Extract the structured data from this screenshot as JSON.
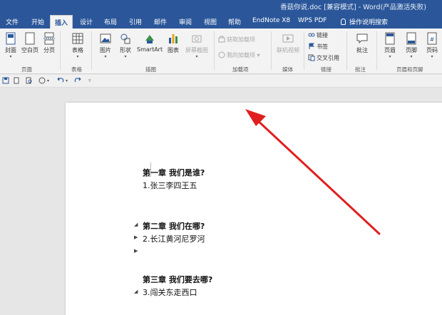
{
  "window": {
    "title": "香菇你说.doc [兼容模式] - Word(产品激活失败)"
  },
  "tabs": [
    {
      "label": "文件"
    },
    {
      "label": "开始"
    },
    {
      "label": "插入"
    },
    {
      "label": "设计"
    },
    {
      "label": "布局"
    },
    {
      "label": "引用"
    },
    {
      "label": "邮件"
    },
    {
      "label": "审阅"
    },
    {
      "label": "视图"
    },
    {
      "label": "帮助"
    },
    {
      "label": "EndNote X8"
    },
    {
      "label": "WPS PDF"
    },
    {
      "label": "操作说明搜索"
    }
  ],
  "active_tab": "插入",
  "ribbon": {
    "pages": {
      "group": "页面",
      "cover": "封面",
      "blank": "空白页",
      "break": "分页"
    },
    "tables": {
      "group": "表格",
      "table": "表格"
    },
    "illustrations": {
      "group": "插图",
      "picture": "图片",
      "shapes": "形状",
      "smartart": "SmartArt",
      "chart": "图表",
      "screenshot": "屏幕截图"
    },
    "addins": {
      "group": "加载项",
      "get": "获取加载项",
      "my": "我的加载项"
    },
    "media": {
      "group": "媒体",
      "video": "联机视频"
    },
    "links": {
      "group": "链接",
      "link": "链接",
      "bookmark": "书签",
      "crossref": "交叉引用"
    },
    "comments": {
      "group": "批注",
      "comment": "批注"
    },
    "headerfooter": {
      "group": "页眉和页脚",
      "header": "页眉",
      "footer": "页脚",
      "pagenum": "页码"
    }
  },
  "document": {
    "lines": [
      "第一章  我们是谁?",
      "1.张三李四王五",
      "第二章  我们在哪?",
      "2.长江黄河尼罗河",
      "第三章  我们要去哪?",
      "3.闯关东走西口"
    ]
  },
  "colors": {
    "brand": "#2b579a",
    "arrow": "#e02020"
  }
}
